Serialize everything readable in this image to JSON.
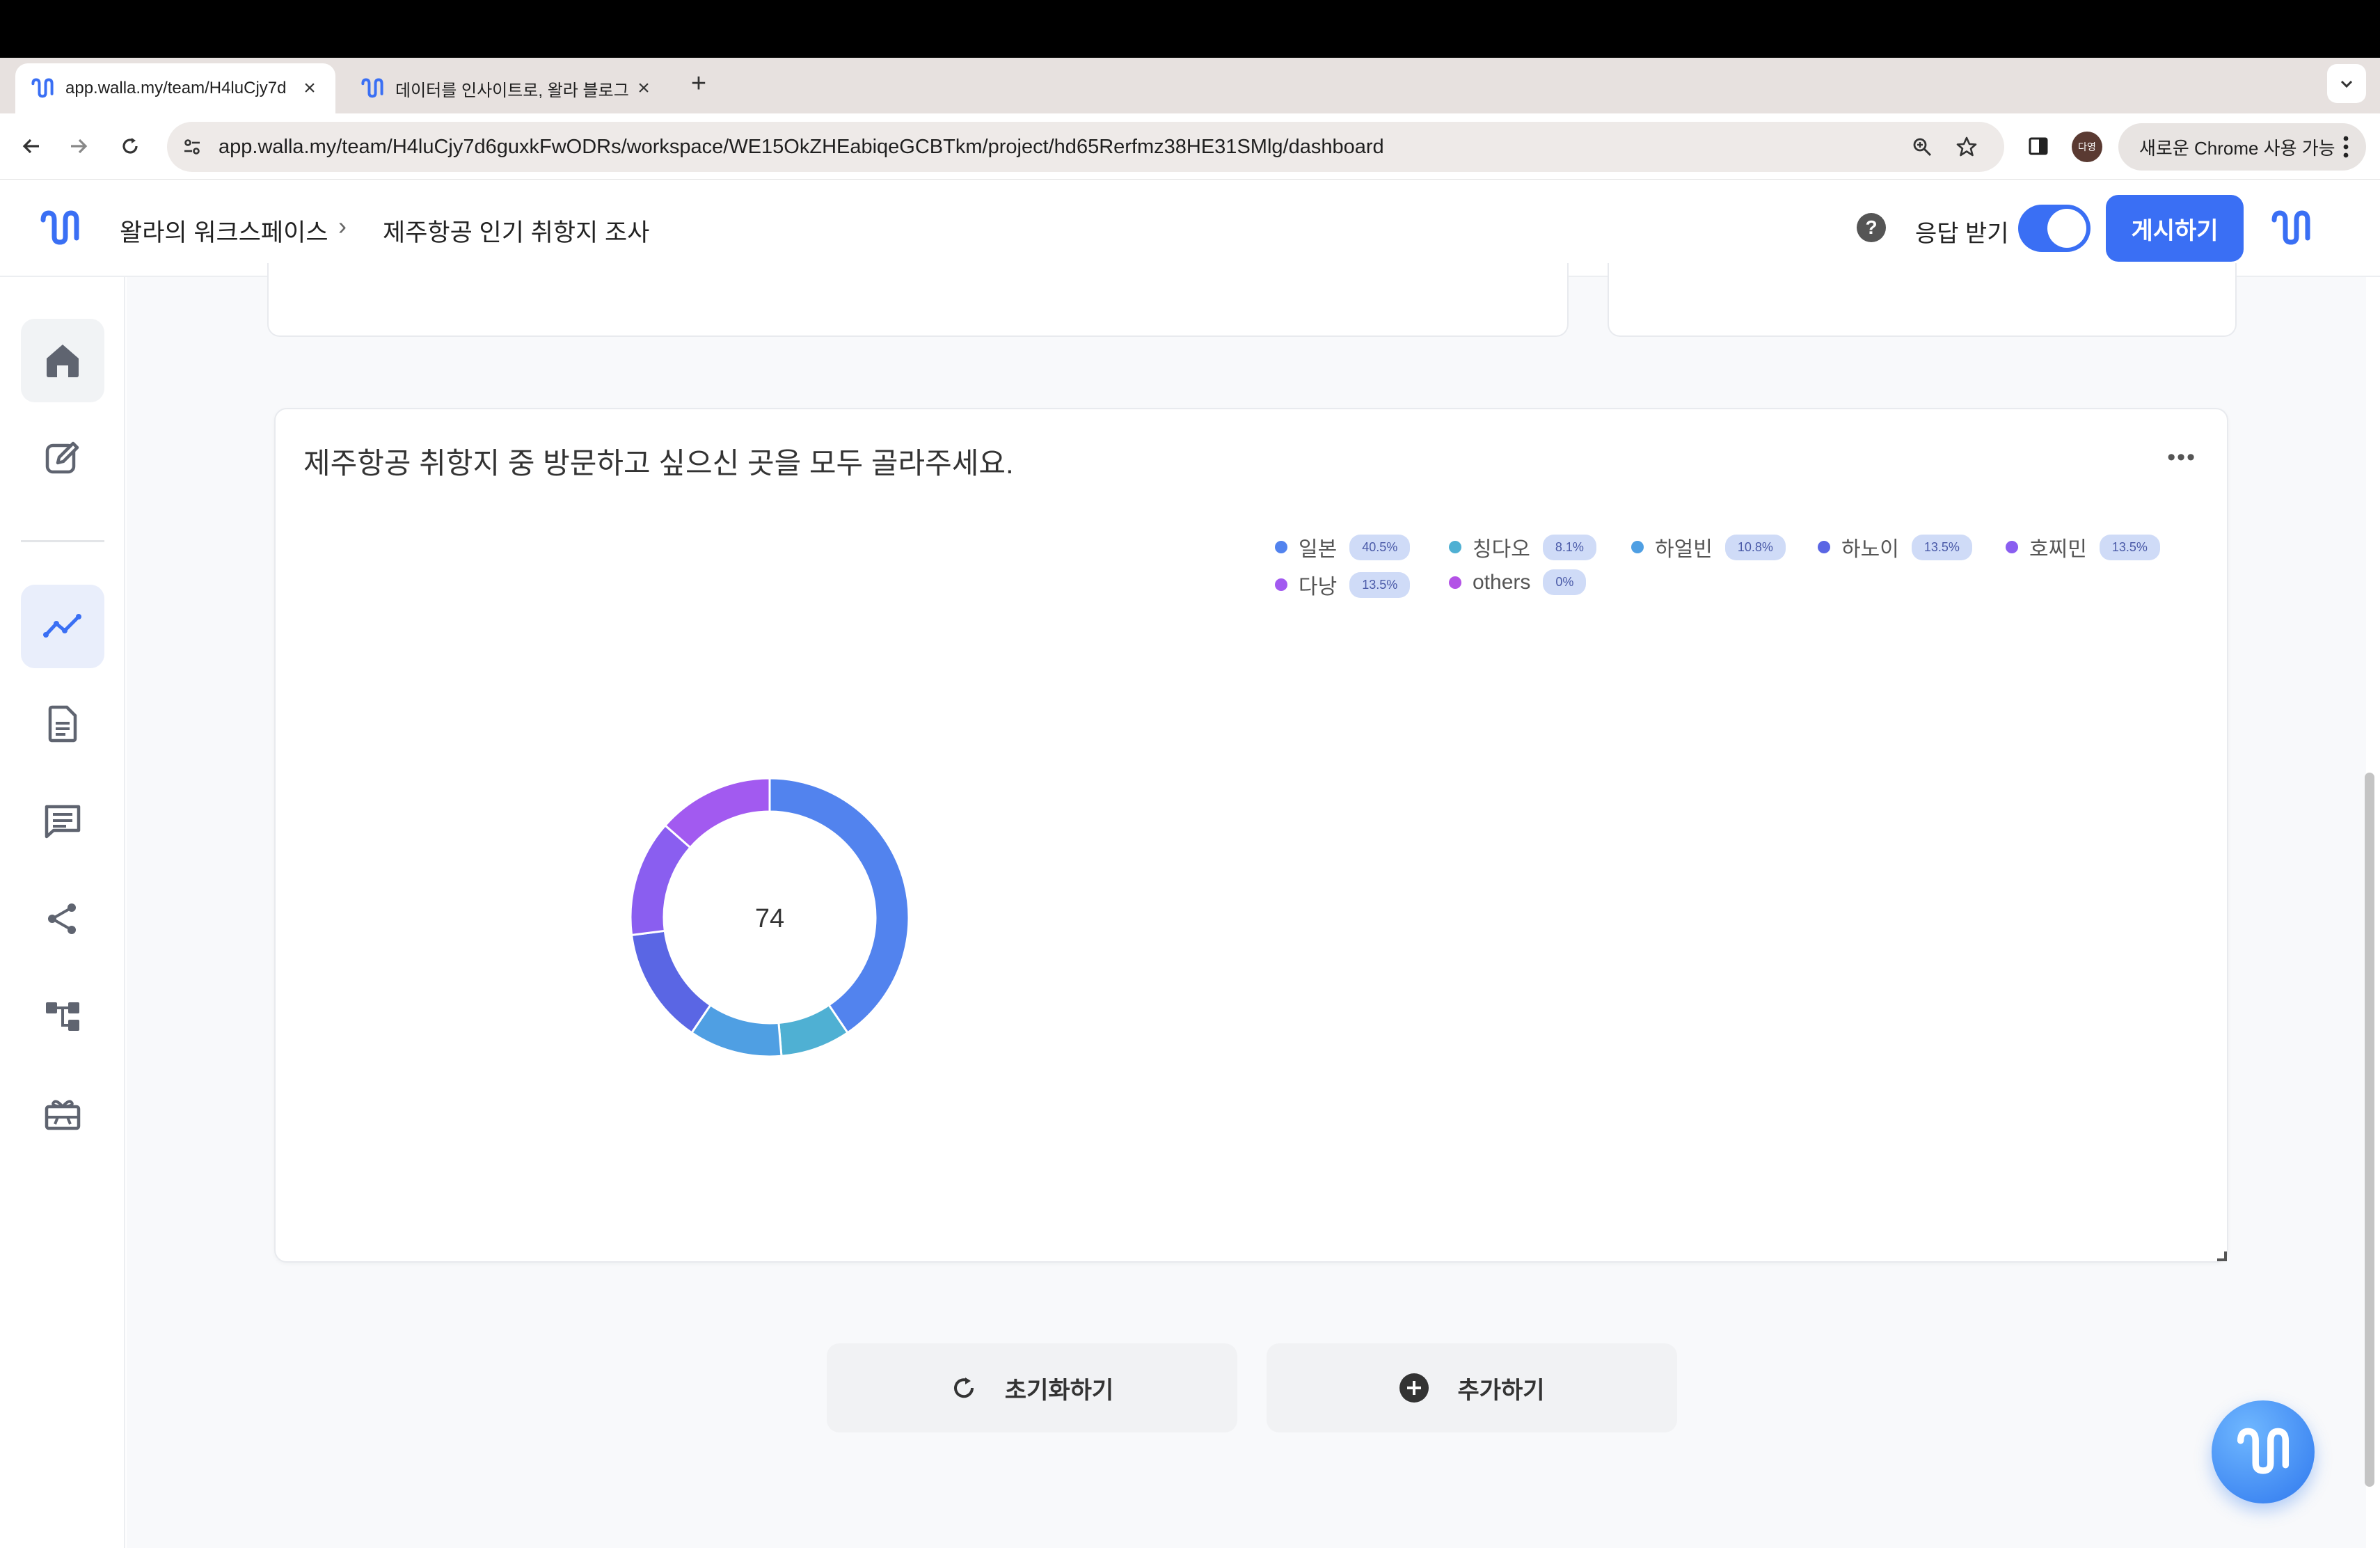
{
  "browser": {
    "tabs": [
      {
        "title": "app.walla.my/team/H4luCjy7d",
        "active": true
      },
      {
        "title": "데이터를 인사이트로, 왈라 블로그",
        "active": false
      }
    ],
    "url": "app.walla.my/team/H4luCjy7d6guxkFwODRs/workspace/WE15OkZHEabiqeGCBTkm/project/hd65Rerfmz38HE31SMlg/dashboard",
    "profile_initials": "다영",
    "chrome_notice": "새로운 Chrome 사용 가능"
  },
  "header": {
    "workspace": "왈라의 워크스페이스",
    "separator": "›",
    "project": "제주항공 인기 취항지 조사",
    "help": "?",
    "response_label": "응답 받기",
    "response_on": true,
    "publish_label": "게시하기"
  },
  "sidebar": {
    "items": [
      {
        "name": "home",
        "icon": "home-icon"
      },
      {
        "name": "edit",
        "icon": "edit-icon"
      },
      {
        "name": "analytics",
        "icon": "chart-line-icon",
        "active": true
      },
      {
        "name": "document",
        "icon": "document-icon"
      },
      {
        "name": "responses",
        "icon": "message-icon"
      },
      {
        "name": "share",
        "icon": "share-icon"
      },
      {
        "name": "logic",
        "icon": "flow-icon"
      },
      {
        "name": "rewards",
        "icon": "gift-icon"
      }
    ]
  },
  "chart_card": {
    "question": "제주항공 취항지 중 방문하고 싶으신 곳을 모두 골라주세요.",
    "more": "•••",
    "total": "74"
  },
  "chart_data": {
    "type": "pie",
    "center_label": "74",
    "categories": [
      "일본",
      "칭다오",
      "하얼빈",
      "하노이",
      "호찌민",
      "다낭",
      "others"
    ],
    "values": [
      40.5,
      8.1,
      10.8,
      13.5,
      13.5,
      13.5,
      0
    ],
    "value_labels": [
      "40.5%",
      "8.1%",
      "10.8%",
      "13.5%",
      "13.5%",
      "13.5%",
      "0%"
    ],
    "colors": [
      "#5283ee",
      "#4fb0d3",
      "#4f9fe3",
      "#5a66e4",
      "#8a5ef0",
      "#a25af0",
      "#b352e6"
    ],
    "legend_position": "top-right"
  },
  "actions": {
    "reset_label": "초기화하기",
    "add_label": "추가하기"
  }
}
